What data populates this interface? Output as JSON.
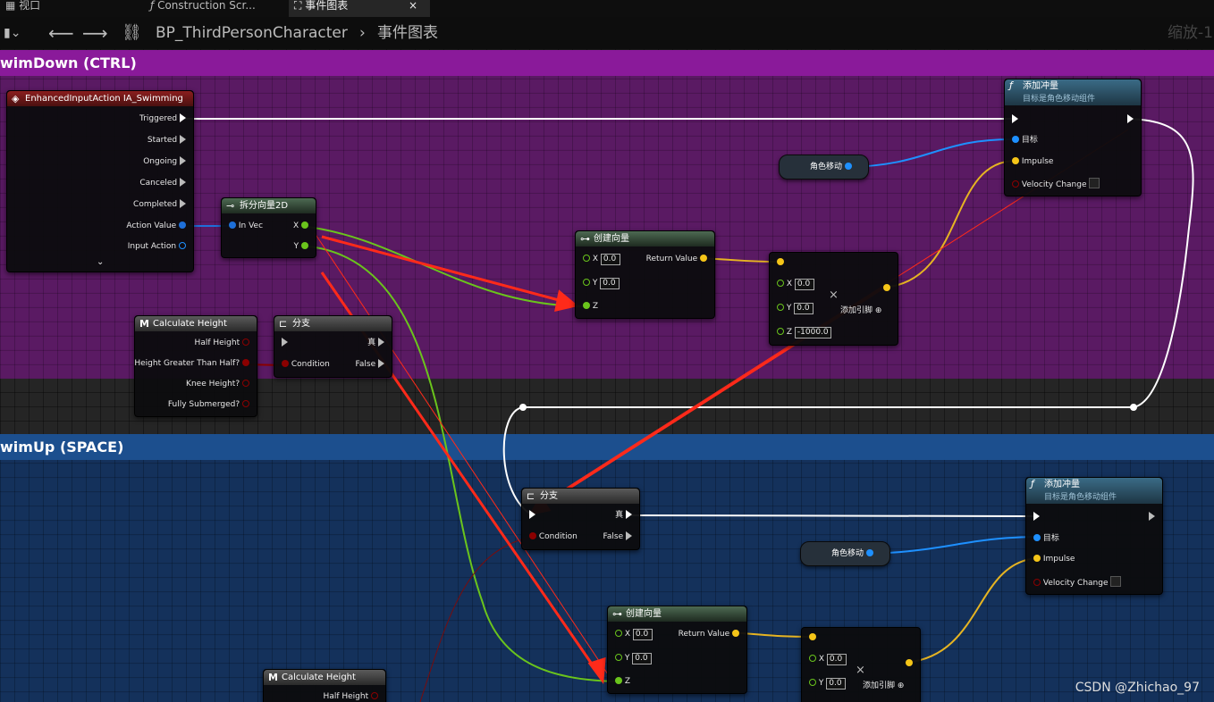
{
  "tabs": [
    {
      "label": "视口",
      "icon": "grid-icon"
    },
    {
      "label": "Construction Scr...",
      "icon": "function-icon"
    },
    {
      "label": "事件图表",
      "icon": "graph-icon",
      "close": "×"
    }
  ],
  "toolbar": {
    "breadcrumb_root": "BP_ThirdPersonCharacter",
    "breadcrumb_sep": "›",
    "breadcrumb_current": "事件图表",
    "zoom": "缩放-1"
  },
  "comments": {
    "swim_down": "wimDown  (CTRL)",
    "swim_up": "wimUp (SPACE)"
  },
  "input_node": {
    "title": "EnhancedInputAction IA_Swimming",
    "pins": [
      "Triggered",
      "Started",
      "Ongoing",
      "Canceled",
      "Completed",
      "Action Value",
      "Input Action"
    ]
  },
  "break_vector": {
    "title": "拆分向量2D",
    "in": "In Vec",
    "x": "X",
    "y": "Y"
  },
  "make_vector_1": {
    "title": "创建向量",
    "x": "X",
    "y": "Y",
    "z": "Z",
    "xv": "0.0",
    "yv": "0.0",
    "ret": "Return Value"
  },
  "add_pin_node_1": {
    "x": "X",
    "y": "Y",
    "z": "Z",
    "xv": "0.0",
    "yv": "0.0",
    "zv": "-1000.0",
    "add": "添加引脚"
  },
  "impulse_1": {
    "title": "添加冲量",
    "subtitle": "目标是角色移动组件",
    "target": "目标",
    "impulse": "Impulse",
    "vel": "Velocity Change"
  },
  "char_move_1": "角色移动",
  "calc_height_1": {
    "title": "Calculate Height",
    "pins": [
      "Half Height",
      "Height Greater Than Half?",
      "Knee Height?",
      "Fully Submerged?"
    ]
  },
  "branch_1": {
    "title": "分支",
    "true": "真",
    "cond": "Condition",
    "false": "False"
  },
  "branch_2": {
    "title": "分支",
    "true": "真",
    "cond": "Condition",
    "false": "False"
  },
  "impulse_2": {
    "title": "添加冲量",
    "subtitle": "目标是角色移动组件",
    "target": "目标",
    "impulse": "Impulse",
    "vel": "Velocity Change"
  },
  "char_move_2": "角色移动",
  "make_vector_2": {
    "title": "创建向量",
    "x": "X",
    "y": "Y",
    "z": "Z",
    "xv": "0.0",
    "yv": "0.0",
    "ret": "Return Value"
  },
  "add_pin_node_2": {
    "x": "X",
    "y": "Y",
    "xv": "0.0",
    "yv": "0.0",
    "add": "添加引脚"
  },
  "calc_height_2": {
    "title": "Calculate Height",
    "pins": [
      "Half Height"
    ]
  },
  "watermark": "CSDN @Zhichao_97",
  "colors": {
    "exec": "#ffffff",
    "vector": "#f5c518",
    "float": "#7ed321",
    "object": "#1e90ff",
    "bool": "#8b0000",
    "annotation": "#ff2a1a"
  }
}
